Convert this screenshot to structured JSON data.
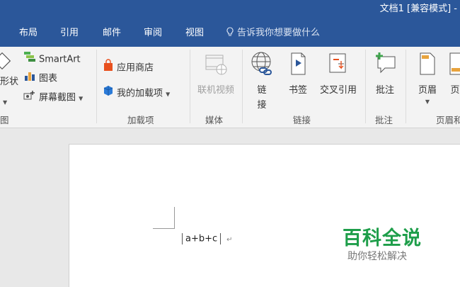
{
  "window": {
    "title": "文档1 [兼容模式] - "
  },
  "tabs": [
    {
      "label": "布局"
    },
    {
      "label": "引用"
    },
    {
      "label": "邮件"
    },
    {
      "label": "审阅"
    },
    {
      "label": "视图"
    }
  ],
  "tell_me": {
    "text": "告诉我你想要做什么"
  },
  "ribbon": {
    "illustrations": {
      "shapes_label": "形状",
      "smartart_label": "SmartArt",
      "chart_label": "图表",
      "screenshot_label": "屏幕截图",
      "group_label": "图"
    },
    "addins": {
      "store_label": "应用商店",
      "my_addins_label": "我的加载项",
      "group_label": "加载项"
    },
    "media": {
      "online_video_label": "联机视频",
      "group_label": "媒体"
    },
    "links": {
      "link_label_1": "链",
      "link_label_2": "接",
      "bookmark_label": "书签",
      "crossref_label": "交叉引用",
      "group_label": "链接"
    },
    "comments": {
      "comment_label": "批注",
      "group_label": "批注"
    },
    "header_footer": {
      "header_label": "页眉",
      "footer_label": "页",
      "group_label": "页眉和"
    }
  },
  "document": {
    "equation_text": "a+b+c",
    "paragraph_mark": "↵"
  },
  "watermark": {
    "main_text": "百科全说",
    "sub_text": "助你轻松解决"
  },
  "colors": {
    "accent": "#2b579a",
    "ribbon_bg": "#f3f3f3",
    "watermark_green": "#1e9e4a"
  }
}
